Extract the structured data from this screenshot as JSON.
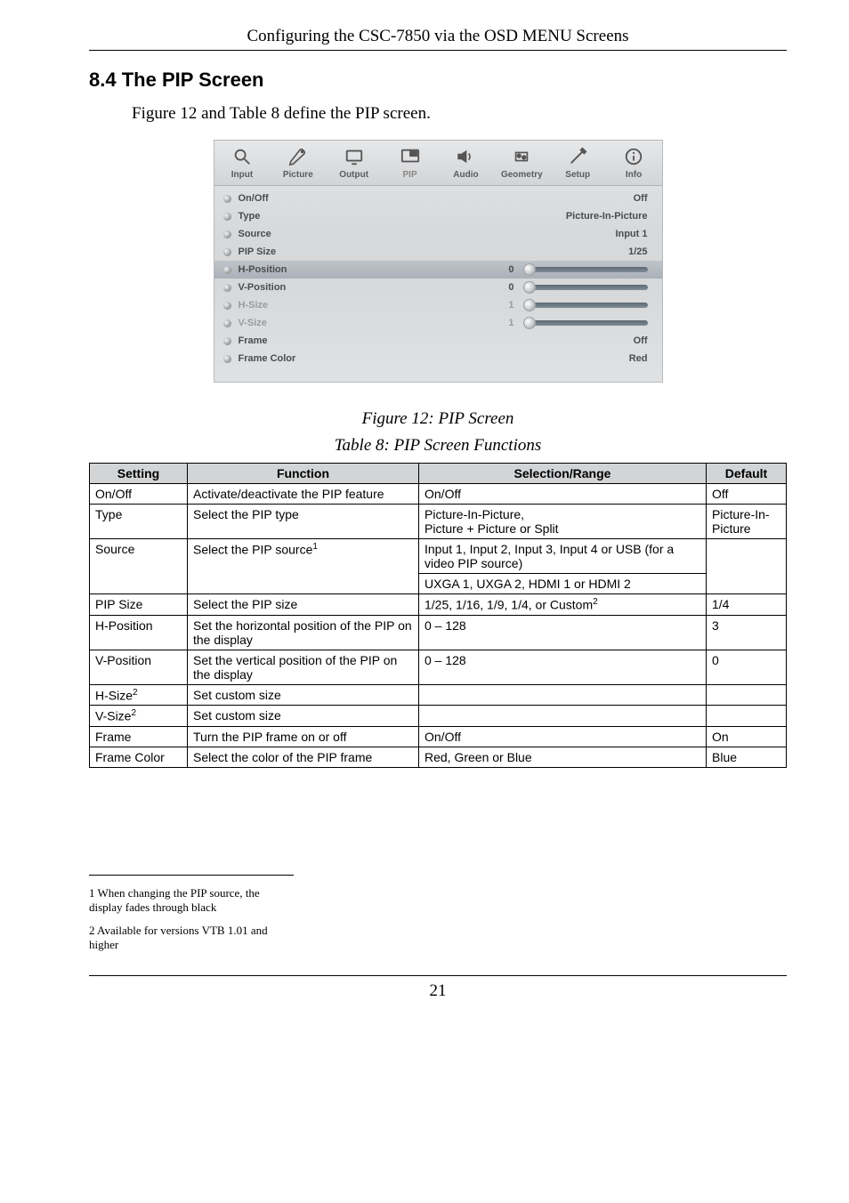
{
  "chapter_header": "Configuring the CSC-7850 via the OSD MENU Screens",
  "section_number": "8.4",
  "section_title": "The PIP Screen",
  "intro_line": "Figure 12 and Table 8 define the PIP screen.",
  "figure_caption": "Figure 12: PIP Screen",
  "table_caption": "Table 8: PIP Screen Functions",
  "tabs": [
    {
      "name": "input-tab",
      "label": "Input",
      "icon": "magnifier"
    },
    {
      "name": "picture-tab",
      "label": "Picture",
      "icon": "palette"
    },
    {
      "name": "output-tab",
      "label": "Output",
      "icon": "monitor"
    },
    {
      "name": "pip-tab",
      "label": "PIP",
      "icon": "pip",
      "selected": true
    },
    {
      "name": "audio-tab",
      "label": "Audio",
      "icon": "speaker"
    },
    {
      "name": "geometry-tab",
      "label": "Geometry",
      "icon": "geometry"
    },
    {
      "name": "setup-tab",
      "label": "Setup",
      "icon": "tools"
    },
    {
      "name": "info-tab",
      "label": "Info",
      "icon": "info"
    }
  ],
  "osd_rows": [
    {
      "name": "onoff",
      "label": "On/Off",
      "value": "Off",
      "type": "text"
    },
    {
      "name": "type",
      "label": "Type",
      "value": "Picture-In-Picture",
      "type": "text"
    },
    {
      "name": "source",
      "label": "Source",
      "value": "Input 1",
      "type": "text"
    },
    {
      "name": "pipsize",
      "label": "PIP Size",
      "value": "1/25",
      "type": "text"
    },
    {
      "name": "hposition",
      "label": "H-Position",
      "value": "0",
      "type": "slider",
      "knob": 0,
      "highlight": true
    },
    {
      "name": "vposition",
      "label": "V-Position",
      "value": "0",
      "type": "slider",
      "knob": 0
    },
    {
      "name": "hsize",
      "label": "H-Size",
      "value": "1",
      "type": "slider",
      "knob": 0,
      "dim": true
    },
    {
      "name": "vsize",
      "label": "V-Size",
      "value": "1",
      "type": "slider",
      "knob": 0,
      "dim": true
    },
    {
      "name": "frame",
      "label": "Frame",
      "value": "Off",
      "type": "text"
    },
    {
      "name": "framecolor",
      "label": "Frame Color",
      "value": "Red",
      "type": "text"
    }
  ],
  "table": {
    "headers": {
      "setting": "Setting",
      "function": "Function",
      "range": "Selection/Range",
      "default": "Default"
    },
    "rows": [
      {
        "setting": "On/Off",
        "function": "Activate/deactivate the PIP feature",
        "range": "On/Off",
        "default": "Off"
      },
      {
        "setting": "Type",
        "function": "Select the PIP type",
        "range": "Picture-In-Picture,\nPicture + Picture or Split",
        "default": "Picture-In-Picture"
      },
      {
        "setting": "Source",
        "function_html": "Select the PIP source<sup class='sup'>1</sup>",
        "range": "Input 1, Input 2, Input 3, Input 4 or USB (for a video PIP source)",
        "range2": "UXGA 1, UXGA 2, HDMI 1 or HDMI 2",
        "default": ""
      },
      {
        "setting": "PIP Size",
        "function": "Select the PIP size",
        "range_html": "1/25, 1/16, 1/9, 1/4, or Custom<sup class='sup'>2</sup>",
        "default": "1/4"
      },
      {
        "setting": "H-Position",
        "function": "Set the horizontal position of the PIP on the display",
        "range": "0 – 128",
        "default": "3"
      },
      {
        "setting": "V-Position",
        "function": "Set the vertical position of the PIP on the display",
        "range": "0 – 128",
        "default": "0"
      },
      {
        "setting_html": "H-Size<sup class='sup'>2</sup>",
        "function": "Set custom size",
        "range": "",
        "default": ""
      },
      {
        "setting_html": "V-Size<sup class='sup'>2</sup>",
        "function": "Set custom size",
        "range": "",
        "default": ""
      },
      {
        "setting": "Frame",
        "function": "Turn the PIP frame on or off",
        "range": "On/Off",
        "default": "On"
      },
      {
        "setting": "Frame Color",
        "function": "Select the color of the PIP frame",
        "range": "Red, Green or Blue",
        "default": "Blue"
      }
    ]
  },
  "footnotes": {
    "fn1": "1 When changing the PIP source, the display fades through black",
    "fn2": "2 Available for versions VTB 1.01 and higher"
  },
  "page_number": "21"
}
